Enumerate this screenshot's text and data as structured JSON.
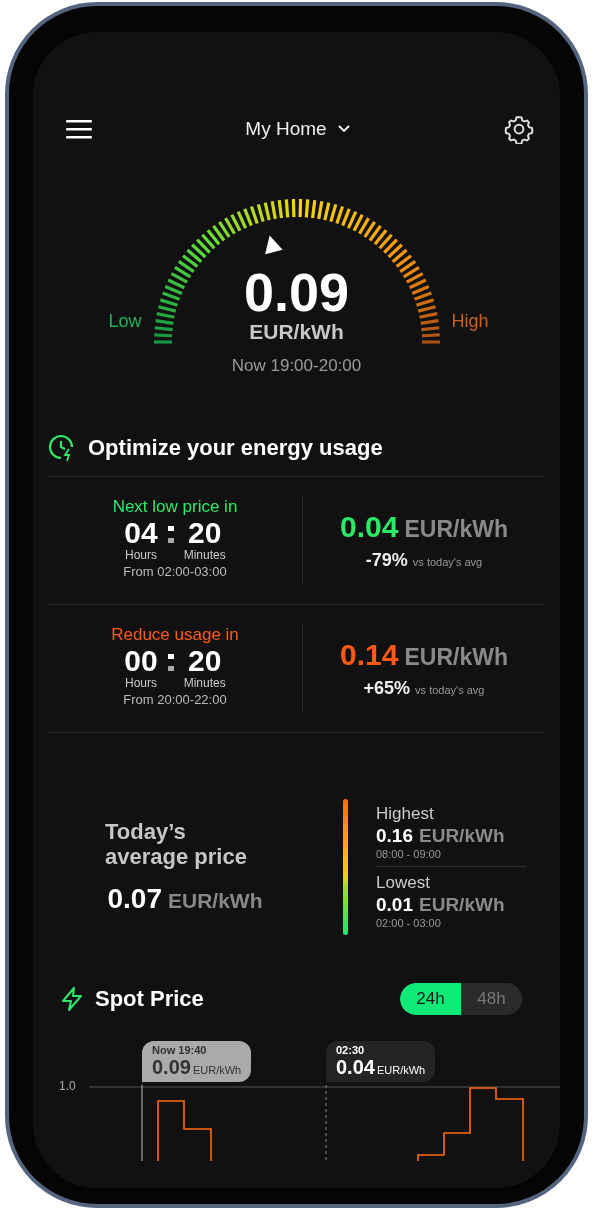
{
  "header": {
    "home_selector": "My Home"
  },
  "gauge": {
    "price": "0.09",
    "unit": "EUR/kWh",
    "low_label": "Low",
    "high_label": "High",
    "period": "Now 19:00-20:00"
  },
  "optimize": {
    "title": "Optimize your energy usage",
    "rows": [
      {
        "label": "Next low price in",
        "color": "#2ee86a",
        "hours": "04",
        "minutes": "20",
        "hours_label": "Hours",
        "minutes_label": "Minutes",
        "from": "From 02:00-03:00",
        "price": "0.04",
        "unit": "EUR/kWh",
        "change": "-79%",
        "change_note": "vs today's avg"
      },
      {
        "label": "Reduce usage in",
        "color": "#ff5a14",
        "hours": "00",
        "minutes": "20",
        "hours_label": "Hours",
        "minutes_label": "Minutes",
        "from": "From 20:00-22:00",
        "price": "0.14",
        "unit": "EUR/kWh",
        "change": "+65%",
        "change_note": "vs today's avg"
      }
    ]
  },
  "average": {
    "title": "Today’s average price",
    "price": "0.07",
    "unit": "EUR/kWh",
    "extremes": [
      {
        "label": "Highest",
        "price": "0.16",
        "unit": "EUR/kWh",
        "time": "08:00 - 09:00"
      },
      {
        "label": "Lowest",
        "price": "0.01",
        "unit": "EUR/kWh",
        "time": "02:00 - 03:00"
      }
    ]
  },
  "spot_price": {
    "title": "Spot Price",
    "ranges": [
      {
        "label": "24h",
        "selected": true
      },
      {
        "label": "48h",
        "selected": false
      }
    ],
    "y_tick": "1.0",
    "markers": [
      {
        "kind": "now",
        "time": "Now 19:40",
        "price": "0.09",
        "unit": "EUR/kWh"
      },
      {
        "kind": "next",
        "time": "02:30",
        "price": "0.04",
        "unit": "EUR/kWh"
      }
    ]
  }
}
